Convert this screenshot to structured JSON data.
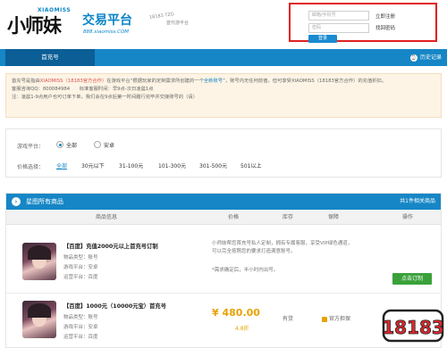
{
  "header": {
    "logo_text": "小师妹",
    "logo_sup": "XIAOMISS",
    "platform_title": "交易平台",
    "platform_url": "888.xiaomiss.COM",
    "slogan_a": "18183 TZG",
    "slogan_b": "首代游平台"
  },
  "login": {
    "username_placeholder": "邮箱/手机号",
    "password_placeholder": "密码",
    "register_link": "立即注册",
    "forgot_link": "找回密码",
    "login_button": "登录"
  },
  "nav": {
    "tab_first_charge": "首充号",
    "history_label": "历史记录",
    "history_icon": "clock-icon"
  },
  "notice": {
    "line1_prefix": "首充号是指由",
    "line1_red": "XIAOMISS（18183官方合作）",
    "line1_mid": "在游戏平台“根据玩家的定制需求所创建的一个",
    "line1_link": "全新账号",
    "line1_suffix": "”，账号内无任何前值，但可享受XIAOMISS（18183官方合作）的充值折扣。",
    "line2": "客服咨询QQ：800084984　　标准客服时间：早9点-次日凌晨1点",
    "line3": "注：凌晨1-9点用户也可订单下单，我们会在9点后第一时间履行完毕并交接账号的（请）"
  },
  "filter": {
    "platform_label": "游戏平台：",
    "platform_options": [
      "全部",
      "安卓"
    ],
    "price_label": "价格选择：",
    "price_options": [
      "全部",
      "30元以下",
      "31-100元",
      "101-300元",
      "301-500元",
      "501以上"
    ]
  },
  "products": {
    "section_title": "星图所有商品",
    "section_more": "共1件相关商品",
    "columns": [
      "商品信息",
      "价格",
      "库存",
      "保障",
      "操作"
    ],
    "items": [
      {
        "title": "【百度】充值2000元以上首充号订制",
        "meta": [
          "物品类型：账号",
          "游戏平台：安卓",
          "运营平台：百度"
        ],
        "desc": "小师妹帮您首充号私人定制，拥有专属客服，享受VIP绿色通道，可以完全按照您的要求打造满意账号。",
        "desc2": "*需求确定后，半小时内出号。",
        "action": "点击订制"
      },
      {
        "title": "【百度】1000元（10000元宝）首充号",
        "meta": [
          "物品类型：账号",
          "游戏平台：安卓",
          "运营平台：百度"
        ],
        "price": "¥ 480.00",
        "discount": "4.8折",
        "stock": "有货",
        "guarantee": "官方担保"
      }
    ]
  },
  "watermark": "18183"
}
